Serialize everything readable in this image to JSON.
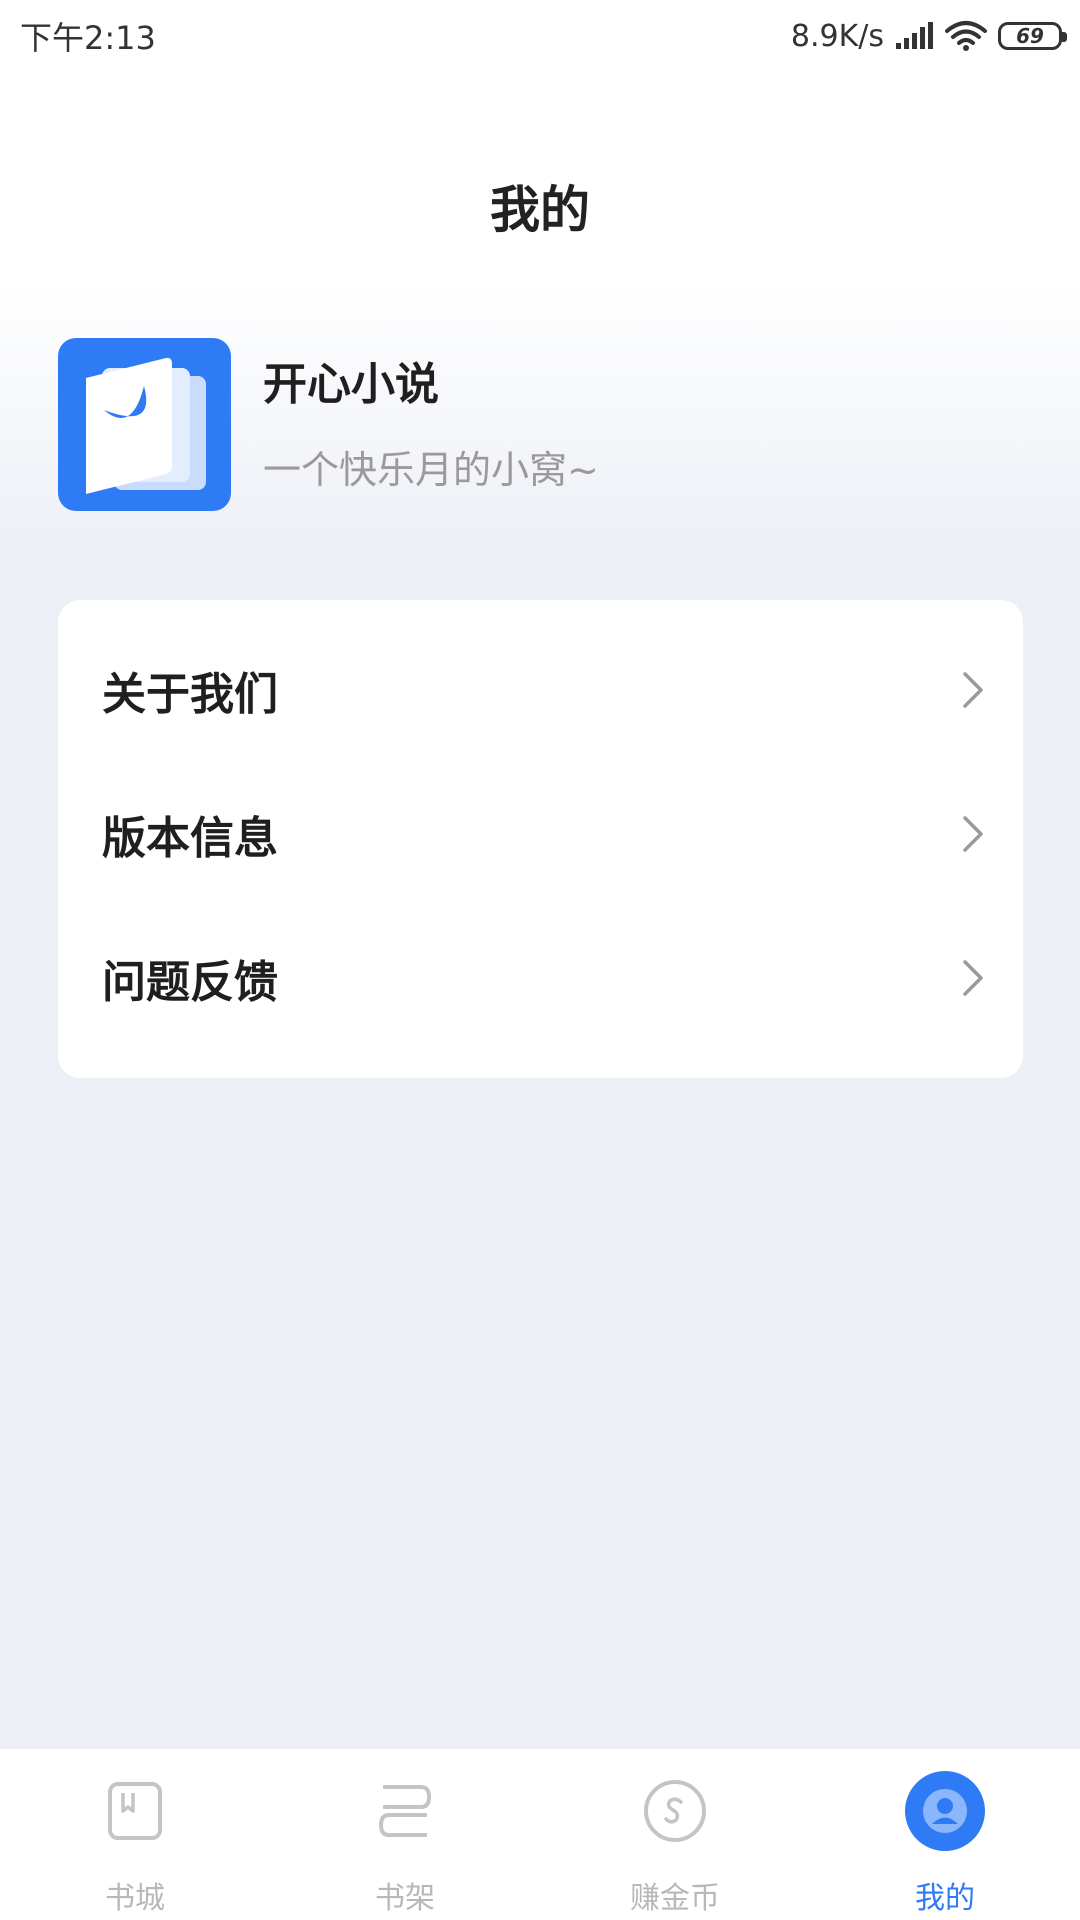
{
  "status_bar": {
    "time": "下午2:13",
    "network_speed": "8.9K/s",
    "battery_level": "69",
    "icons": [
      "signal-icon",
      "wifi-icon",
      "battery-icon"
    ]
  },
  "header": {
    "title": "我的"
  },
  "profile": {
    "app_name": "开心小说",
    "slogan": "一个快乐月的小窝~",
    "logo_icon": "book-moon-logo-icon"
  },
  "menu": {
    "items": [
      {
        "label": "关于我们",
        "icon": "chevron-right-icon"
      },
      {
        "label": "版本信息",
        "icon": "chevron-right-icon"
      },
      {
        "label": "问题反馈",
        "icon": "chevron-right-icon"
      }
    ]
  },
  "bottom_nav": {
    "items": [
      {
        "label": "书城",
        "icon": "bookstore-icon",
        "active": false
      },
      {
        "label": "书架",
        "icon": "bookshelf-icon",
        "active": false
      },
      {
        "label": "赚金币",
        "icon": "coin-icon",
        "active": false
      },
      {
        "label": "我的",
        "icon": "profile-icon",
        "active": true
      }
    ]
  },
  "colors": {
    "accent": "#2f7bf6",
    "background": "#eceff6",
    "inactive": "#b8b8b8"
  }
}
